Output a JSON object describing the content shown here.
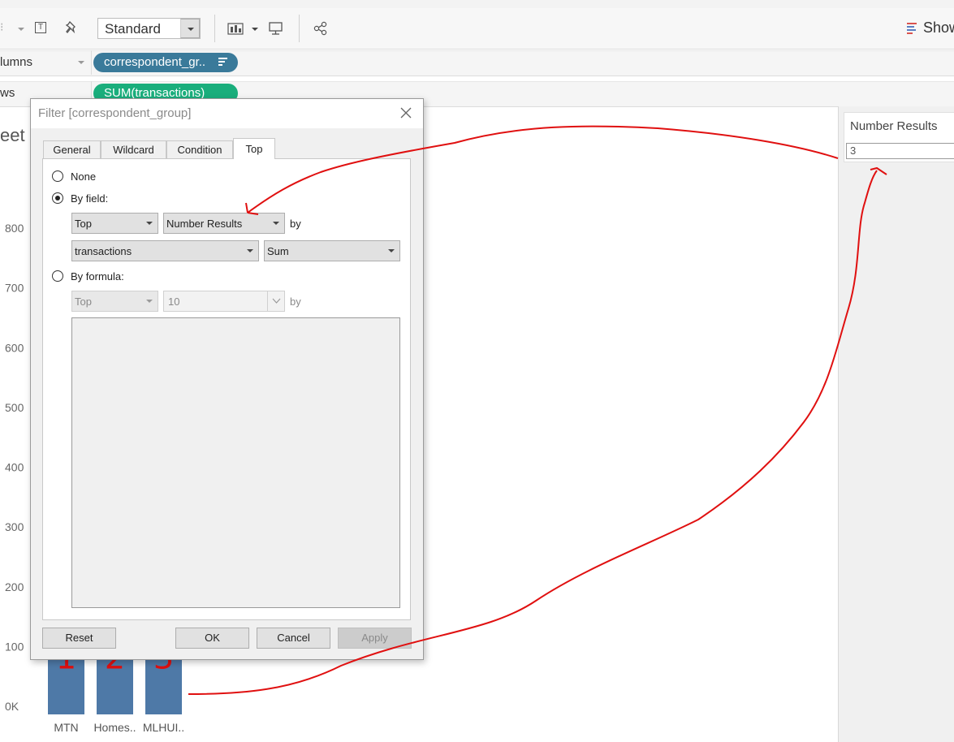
{
  "toolbar": {
    "fit_select": "Standard",
    "show_me": "Show"
  },
  "shelves": {
    "columns_label": "lumns",
    "rows_label": "ws",
    "columns_pill": "correspondent_gr..",
    "rows_pill": "SUM(transactions)"
  },
  "sheet": {
    "title_fragment": "eet"
  },
  "chart_data": {
    "type": "bar",
    "categories": [
      "MTN",
      "Homes..",
      "MLHUI.."
    ],
    "annotations": [
      "1",
      "2",
      "3"
    ],
    "y_tick_labels": [
      "0K",
      "100",
      "200",
      "300",
      "400",
      "500",
      "600",
      "700",
      "800"
    ],
    "values": [
      900,
      900,
      900
    ],
    "ylim": [
      0,
      8500
    ],
    "ylabel": "",
    "title": ""
  },
  "parameter": {
    "title": "Number Results",
    "value": "3"
  },
  "dialog": {
    "title": "Filter [correspondent_group]",
    "tabs": [
      "General",
      "Wildcard",
      "Condition",
      "Top"
    ],
    "active_tab": "Top",
    "none_label": "None",
    "by_field_label": "By field:",
    "by_formula_label": "By formula:",
    "field_top": "Top",
    "field_count": "Number Results",
    "by_text": "by",
    "field_name": "transactions",
    "aggregation": "Sum",
    "formula_top": "Top",
    "formula_count": "10",
    "buttons": {
      "reset": "Reset",
      "ok": "OK",
      "cancel": "Cancel",
      "apply": "Apply"
    }
  },
  "colors": {
    "bar": "#4e79a7",
    "dimension_pill": "#3a7a9a",
    "measure_pill": "#1aae7c",
    "annotation": "#e01010"
  }
}
